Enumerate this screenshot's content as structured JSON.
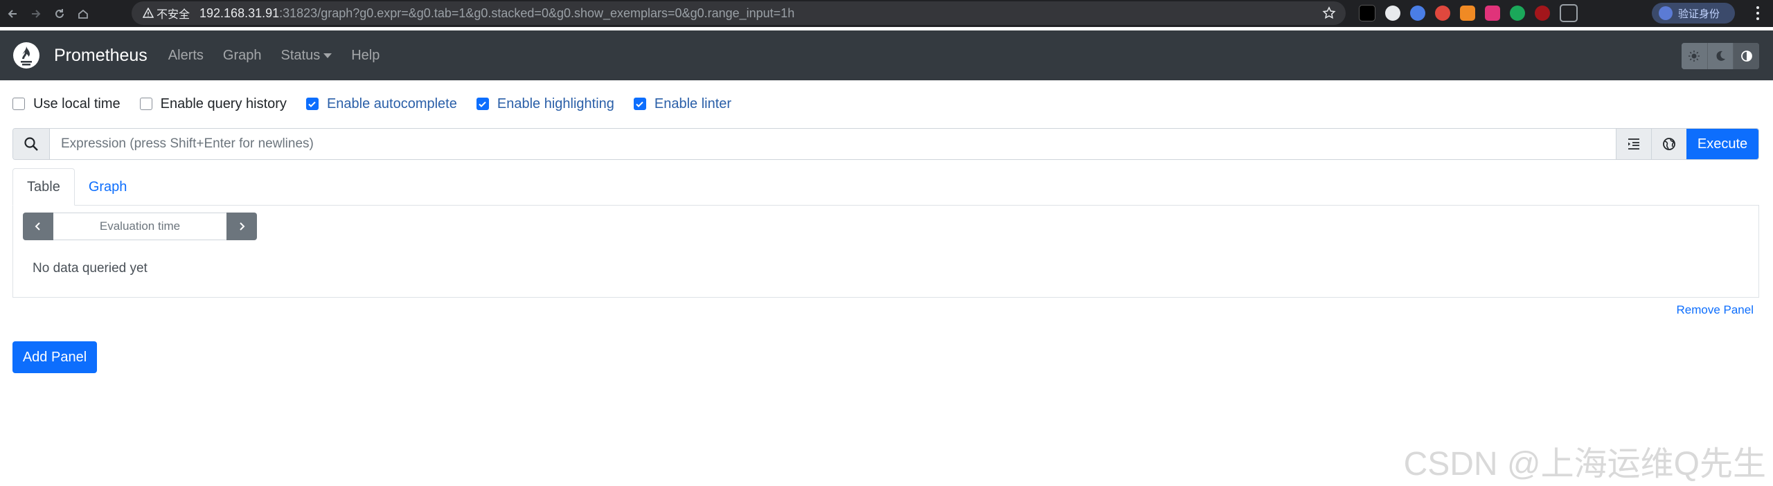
{
  "browser": {
    "security_label": "不安全",
    "url_host": "192.168.31.91",
    "url_rest": ":31823/graph?g0.expr=&g0.tab=1&g0.stacked=0&g0.show_exemplars=0&g0.range_input=1h",
    "profile_label": "验证身份",
    "extensions": [
      "ext-dark",
      "ext-swirl",
      "ext-blue",
      "ext-red",
      "ext-orange",
      "ext-pink",
      "ext-green",
      "ext-ublock",
      "ext-puzzle"
    ]
  },
  "navbar": {
    "brand": "Prometheus",
    "links": [
      "Alerts",
      "Graph",
      "Status",
      "Help"
    ],
    "theme_buttons": [
      "sun-icon",
      "moon-icon",
      "half-circle-icon"
    ]
  },
  "options": [
    {
      "label": "Use local time",
      "checked": false
    },
    {
      "label": "Enable query history",
      "checked": false
    },
    {
      "label": "Enable autocomplete",
      "checked": true
    },
    {
      "label": "Enable highlighting",
      "checked": true
    },
    {
      "label": "Enable linter",
      "checked": true
    }
  ],
  "expression": {
    "placeholder": "Expression (press Shift+Enter for newlines)",
    "value": "",
    "execute_label": "Execute"
  },
  "tabs": {
    "table": "Table",
    "graph": "Graph",
    "active": "Table"
  },
  "panel": {
    "eval_placeholder": "Evaluation time",
    "empty_message": "No data queried yet",
    "remove_label": "Remove Panel"
  },
  "add_panel_label": "Add Panel",
  "watermark": "CSDN @上海运维Q先生",
  "colors": {
    "navbar": "#343a40",
    "primary": "#0d6efd",
    "secondary": "#6c757d"
  }
}
